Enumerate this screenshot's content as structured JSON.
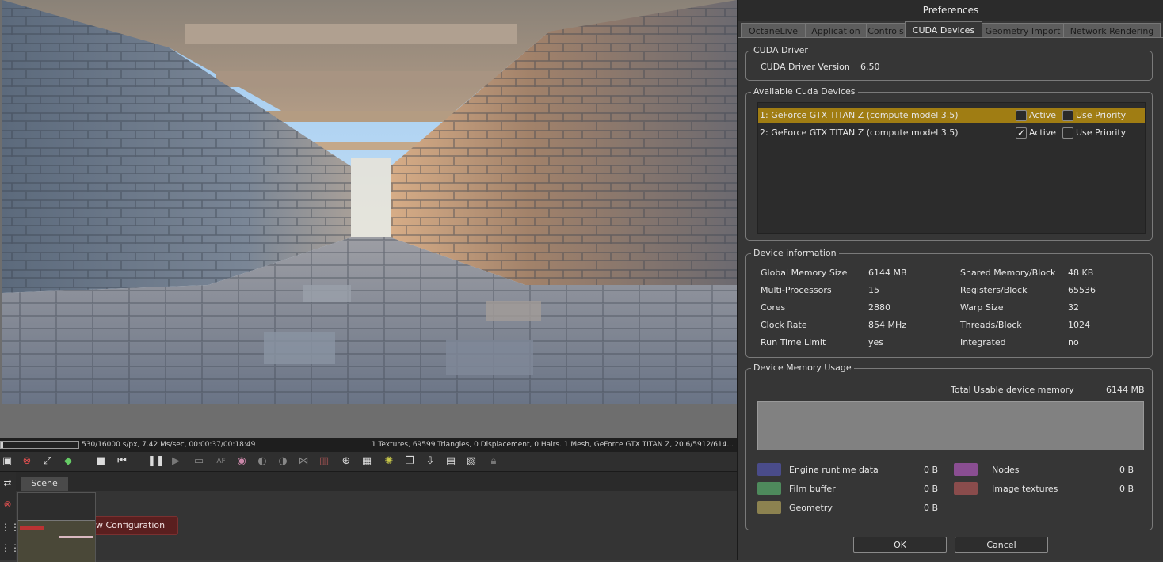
{
  "viewport": {
    "status_left": "530/16000 s/px, 7.42 Ms/sec, 00:00:37/00:18:49",
    "status_right": "1 Textures, 69599 Triangles, 0 Displacement, 0 Hairs. 1 Mesh, GeForce GTX TITAN Z, 20.6/5912/614...",
    "progress_fraction": 0.033,
    "toolbar_icons": [
      "viewport-icon",
      "stop-render-icon",
      "region-icon",
      "cube-icon",
      "stop-icon",
      "rewind-icon",
      "pause-icon",
      "play-icon",
      "monitor-icon",
      "af-icon",
      "color-wheel-icon",
      "sphere-icon",
      "sphere2-icon",
      "nodes-icon",
      "save-image-icon",
      "zoom-icon",
      "grid-icon",
      "palette-icon",
      "copy-icon",
      "export-icon",
      "package-icon",
      "stack-icon",
      "lock-icon"
    ]
  },
  "scene": {
    "tab_label": "Scene",
    "config_button": "w Configuration"
  },
  "prefs": {
    "title": "Preferences",
    "tabs": [
      "OctaneLive",
      "Application",
      "Controls",
      "CUDA Devices",
      "Geometry Import",
      "Network Rendering"
    ],
    "active_tab": "CUDA Devices",
    "driver": {
      "group": "CUDA Driver",
      "label": "CUDA Driver Version",
      "value": "6.50"
    },
    "devices": {
      "group": "Available Cuda Devices",
      "active_label": "Active",
      "priority_label": "Use Priority",
      "items": [
        {
          "name": "1: GeForce GTX TITAN Z (compute model 3.5)",
          "active": false,
          "priority": false
        },
        {
          "name": "2: GeForce GTX TITAN Z (compute model 3.5)",
          "active": true,
          "priority": false
        }
      ]
    },
    "info": {
      "group": "Device information",
      "left": [
        {
          "label": "Global Memory Size",
          "value": "6144 MB"
        },
        {
          "label": "Multi-Processors",
          "value": "15"
        },
        {
          "label": "Cores",
          "value": "2880"
        },
        {
          "label": "Clock Rate",
          "value": "854 MHz"
        },
        {
          "label": "Run Time Limit",
          "value": "yes"
        }
      ],
      "right": [
        {
          "label": "Shared Memory/Block",
          "value": "48 KB"
        },
        {
          "label": "Registers/Block",
          "value": "65536"
        },
        {
          "label": "Warp Size",
          "value": "32"
        },
        {
          "label": "Threads/Block",
          "value": "1024"
        },
        {
          "label": "Integrated",
          "value": "no"
        }
      ]
    },
    "memory": {
      "group": "Device Memory Usage",
      "total_label": "Total Usable device memory",
      "total_value": "6144 MB",
      "legend_left": [
        {
          "label": "Engine runtime data",
          "value": "0 B",
          "color": "#4a4c8a"
        },
        {
          "label": "Film buffer",
          "value": "0 B",
          "color": "#4e8a5c"
        },
        {
          "label": "Geometry",
          "value": "0 B",
          "color": "#8c8250"
        }
      ],
      "legend_right": [
        {
          "label": "Nodes",
          "value": "0 B",
          "color": "#8a4e92"
        },
        {
          "label": "Image textures",
          "value": "0 B",
          "color": "#8a4c4c"
        }
      ]
    },
    "ok_label": "OK",
    "cancel_label": "Cancel"
  }
}
